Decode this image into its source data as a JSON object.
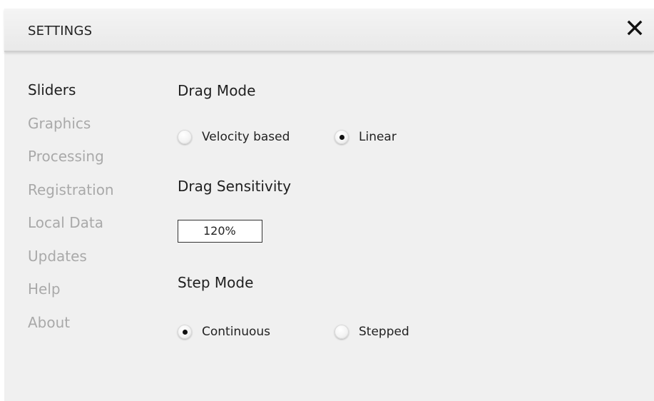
{
  "dialog": {
    "title": "SETTINGS",
    "close_icon": "close-icon"
  },
  "nav": {
    "items": [
      {
        "label": "Sliders",
        "active": true
      },
      {
        "label": "Graphics",
        "active": false
      },
      {
        "label": "Processing",
        "active": false
      },
      {
        "label": "Registration",
        "active": false
      },
      {
        "label": "Local Data",
        "active": false
      },
      {
        "label": "Updates",
        "active": false
      },
      {
        "label": "Help",
        "active": false
      },
      {
        "label": "About",
        "active": false
      }
    ]
  },
  "drag_mode": {
    "heading": "Drag Mode",
    "options": [
      {
        "label": "Velocity based",
        "selected": false
      },
      {
        "label": "Linear",
        "selected": true
      }
    ]
  },
  "drag_sensitivity": {
    "heading": "Drag Sensitivity",
    "value": "120%"
  },
  "step_mode": {
    "heading": "Step Mode",
    "options": [
      {
        "label": "Continuous",
        "selected": true
      },
      {
        "label": "Stepped",
        "selected": false
      }
    ]
  },
  "colors": {
    "active_text": "#1f1f1f",
    "inactive_text": "#a9a9a9",
    "panel_background": "#f0f0f0"
  }
}
